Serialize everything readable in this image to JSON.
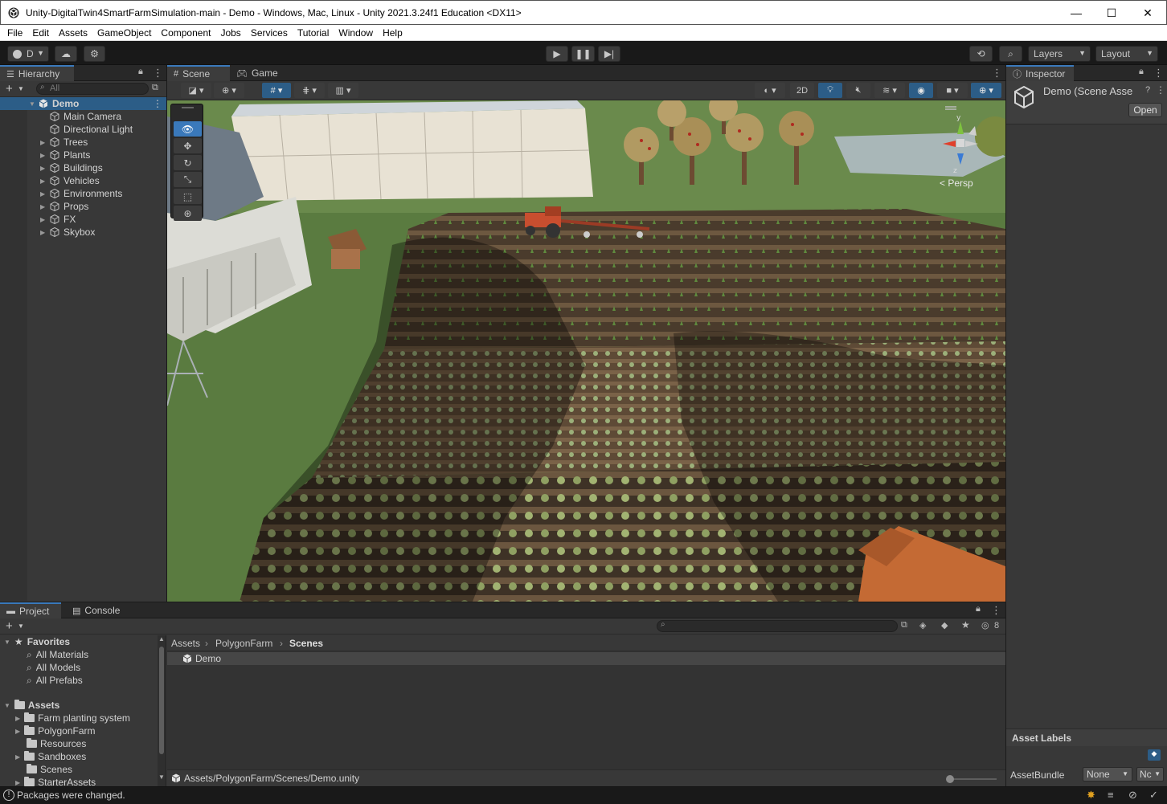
{
  "window": {
    "title": "Unity-DigitalTwin4SmartFarmSimulation-main - Demo - Windows, Mac, Linux - Unity 2021.3.24f1 Education <DX11>",
    "minimize": "—",
    "maximize": "☐",
    "close": "✕"
  },
  "menu": [
    "File",
    "Edit",
    "Assets",
    "GameObject",
    "Component",
    "Jobs",
    "Services",
    "Tutorial",
    "Window",
    "Help"
  ],
  "toolbar": {
    "account_label": "D",
    "layers_label": "Layers",
    "layout_label": "Layout"
  },
  "hierarchy": {
    "tab": "Hierarchy",
    "search_placeholder": "All",
    "scene": "Demo",
    "items": [
      "Main Camera",
      "Directional Light",
      "Trees",
      "Plants",
      "Buildings",
      "Vehicles",
      "Environments",
      "Props",
      "FX",
      "Skybox"
    ]
  },
  "scene": {
    "tab_scene": "Scene",
    "tab_game": "Game",
    "btn_2d": "2D",
    "persp_label": "< Persp",
    "gizmo_y": "y",
    "gizmo_z": "z"
  },
  "inspector": {
    "tab": "Inspector",
    "title": "Demo (Scene Asse",
    "open_button": "Open",
    "asset_labels": "Asset Labels",
    "asset_bundle_label": "AssetBundle",
    "asset_bundle_value": "None",
    "asset_variant_value": "Nc"
  },
  "project": {
    "tab_project": "Project",
    "tab_console": "Console",
    "hidden_count": "8",
    "favorites": "Favorites",
    "favorite_items": [
      "All Materials",
      "All Models",
      "All Prefabs"
    ],
    "assets_root": "Assets",
    "asset_folders": [
      "Farm planting system",
      "PolygonFarm",
      "Resources",
      "Sandboxes",
      "Scenes",
      "StarterAssets"
    ],
    "breadcrumb": [
      "Assets",
      "PolygonFarm",
      "Scenes"
    ],
    "files": [
      "Demo"
    ],
    "footer_path": "Assets/PolygonFarm/Scenes/Demo.unity"
  },
  "status": {
    "message": "Packages were changed."
  },
  "colors": {
    "selection": "#2c5d87",
    "accent": "#3a79bb",
    "panel": "#383838"
  }
}
